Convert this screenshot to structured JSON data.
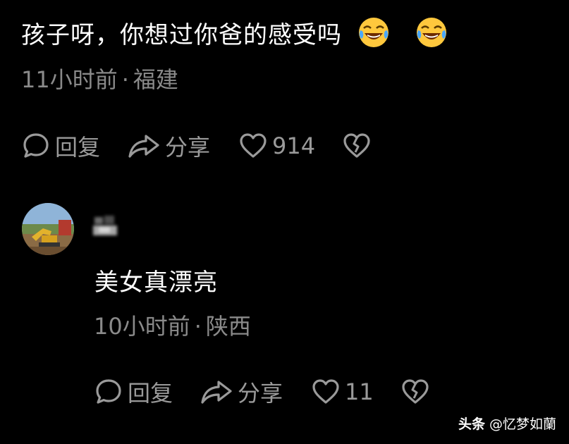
{
  "comment": {
    "text": "孩子呀，你想过你爸的感受吗",
    "emojis": [
      "rolling-laughing-emoji",
      "rolling-laughing-emoji"
    ],
    "time": "11小时前",
    "separator": "·",
    "location": "福建",
    "actions": {
      "reply_label": "回复",
      "share_label": "分享",
      "like_count": "914"
    }
  },
  "reply": {
    "username": "",
    "text": "美女真漂亮",
    "time": "10小时前",
    "separator": "·",
    "location": "陕西",
    "actions": {
      "reply_label": "回复",
      "share_label": "分享",
      "like_count": "11"
    }
  },
  "watermark": {
    "brand": "头条",
    "handle": "@忆梦如蘭"
  },
  "colors": {
    "background": "#000000",
    "text": "#ffffff",
    "muted": "#8a8a8a",
    "icon": "#9a9a9a"
  }
}
